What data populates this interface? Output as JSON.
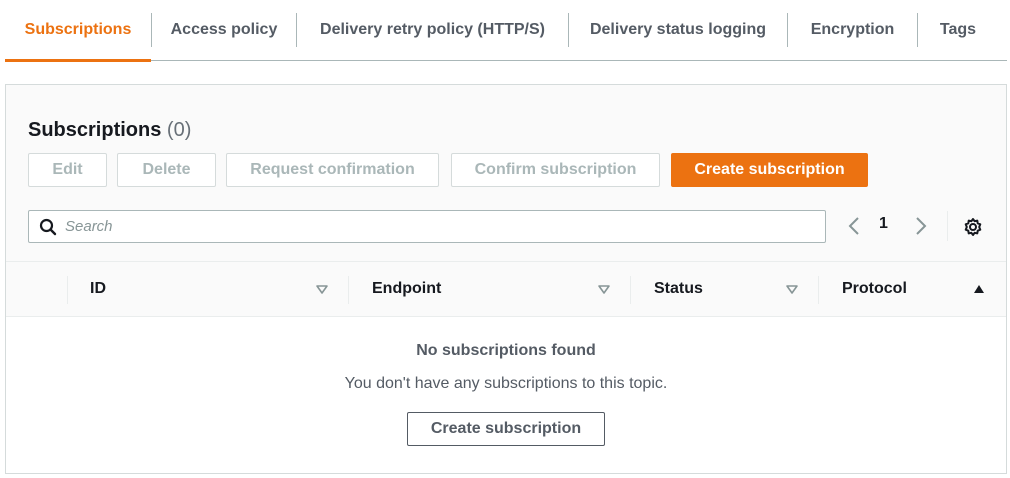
{
  "tabs": [
    {
      "label": "Subscriptions",
      "active": true
    },
    {
      "label": "Access policy",
      "active": false
    },
    {
      "label": "Delivery retry policy (HTTP/S)",
      "active": false
    },
    {
      "label": "Delivery status logging",
      "active": false
    },
    {
      "label": "Encryption",
      "active": false
    },
    {
      "label": "Tags",
      "active": false
    }
  ],
  "panel": {
    "title": "Subscriptions",
    "count": "(0)"
  },
  "actions": {
    "edit": "Edit",
    "delete": "Delete",
    "request_confirmation": "Request confirmation",
    "confirm_subscription": "Confirm subscription",
    "create_subscription": "Create subscription"
  },
  "search": {
    "placeholder": "Search",
    "value": ""
  },
  "pagination": {
    "current_page": "1"
  },
  "table": {
    "columns": [
      "ID",
      "Endpoint",
      "Status",
      "Protocol"
    ],
    "sorted_column": "Protocol",
    "sort_direction": "ascending"
  },
  "empty_state": {
    "title": "No subscriptions found",
    "description": "You don't have any subscriptions to this topic.",
    "button": "Create subscription"
  },
  "colors": {
    "accent": "#ec7211",
    "text": "#16191f",
    "muted": "#545b64",
    "disabled": "#aab7b8"
  },
  "icons": {
    "search": "search-icon",
    "prev": "chevron-left-icon",
    "next": "chevron-right-icon",
    "settings": "gear-icon",
    "sort_inactive": "caret-down-icon",
    "sort_active": "caret-up-icon"
  }
}
